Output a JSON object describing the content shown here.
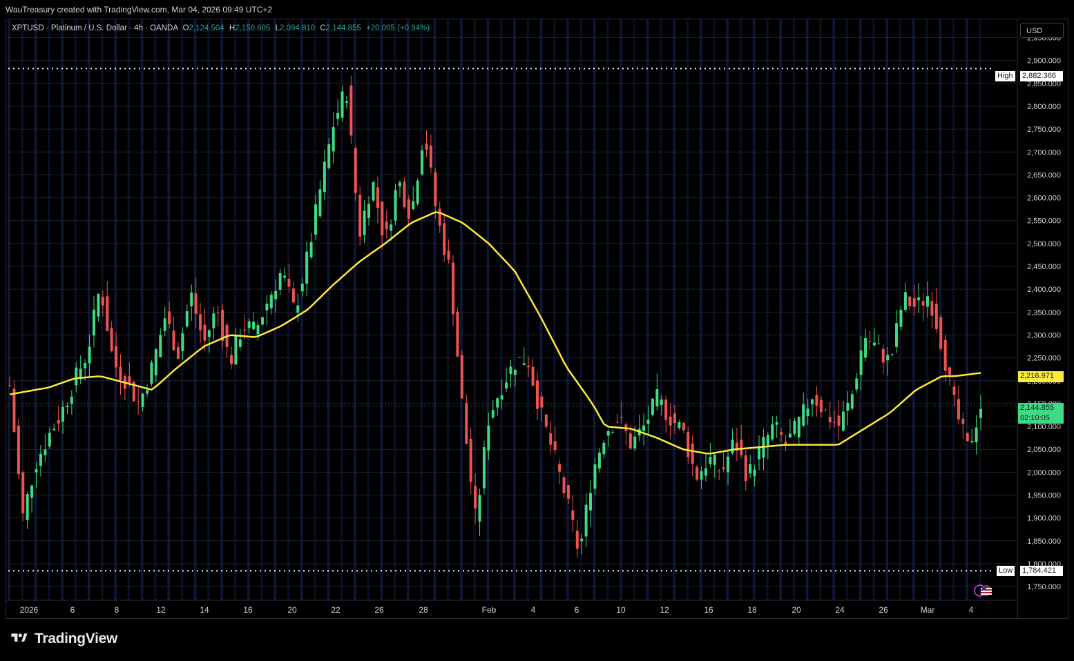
{
  "header": {
    "attribution": "WauTreasury created with TradingView.com, Mar 04, 2026 09:49 UTC+2"
  },
  "legend": {
    "symbol": "XPTUSD",
    "description": "Platinum / U.S. Dollar",
    "interval": "4h",
    "source": "OANDA",
    "open_key": "O",
    "open": "2,124.504",
    "high_key": "H",
    "high": "2,150.605",
    "low_key": "L",
    "low": "2,094.810",
    "close_key": "C",
    "close": "2,144.855",
    "change": "+20.005 (+0.94%)"
  },
  "currency_button": "USD",
  "markers": {
    "high_label": "High",
    "high_value": "2,882.366",
    "low_label": "Low",
    "low_value": "1,784.421",
    "ma_value": "2,216.971",
    "last_price": "2,144.855",
    "countdown": "02:10:05"
  },
  "brand": "TradingView",
  "colors": {
    "up": "#26a69a",
    "up_bright": "#3ddc84",
    "down": "#ef5350",
    "ma": "#ffeb3b",
    "session_band": "#1c2a6e",
    "grid": "#1e222d"
  },
  "chart_data": {
    "type": "candlestick",
    "interval": "4h",
    "ylim": [
      1720,
      2990
    ],
    "y_ticks": [
      "2,950.000",
      "2,900.000",
      "2,850.000",
      "2,800.000",
      "2,750.000",
      "2,700.000",
      "2,650.000",
      "2,600.000",
      "2,550.000",
      "2,500.000",
      "2,450.000",
      "2,400.000",
      "2,350.000",
      "2,300.000",
      "2,250.000",
      "2,200.000",
      "2,150.000",
      "2,100.000",
      "2,050.000",
      "2,000.000",
      "1,950.000",
      "1,900.000",
      "1,850.000",
      "1,800.000",
      "1,750.000"
    ],
    "x_ticks": [
      "2026",
      "6",
      "8",
      "12",
      "14",
      "16",
      "20",
      "22",
      "26",
      "28",
      "Feb",
      "4",
      "6",
      "10",
      "12",
      "16",
      "18",
      "20",
      "24",
      "26",
      "Mar",
      "4"
    ],
    "high": 2882.366,
    "low": 1784.421,
    "last": 2144.855,
    "price_path": [
      [
        0,
        2190
      ],
      [
        1,
        1900
      ],
      [
        2,
        2020
      ],
      [
        3,
        2080
      ],
      [
        4,
        2130
      ],
      [
        5,
        2200
      ],
      [
        6,
        2260
      ],
      [
        7,
        2410
      ],
      [
        8,
        2240
      ],
      [
        9,
        2200
      ],
      [
        10,
        2150
      ],
      [
        11,
        2230
      ],
      [
        12,
        2340
      ],
      [
        13,
        2260
      ],
      [
        14,
        2390
      ],
      [
        15,
        2280
      ],
      [
        16,
        2360
      ],
      [
        17,
        2240
      ],
      [
        18,
        2320
      ],
      [
        19,
        2310
      ],
      [
        20,
        2380
      ],
      [
        21,
        2440
      ],
      [
        22,
        2350
      ],
      [
        23,
        2470
      ],
      [
        24,
        2620
      ],
      [
        25,
        2760
      ],
      [
        26,
        2840
      ],
      [
        27,
        2520
      ],
      [
        28,
        2640
      ],
      [
        29,
        2500
      ],
      [
        30,
        2640
      ],
      [
        31,
        2560
      ],
      [
        32,
        2750
      ],
      [
        33,
        2560
      ],
      [
        34,
        2440
      ],
      [
        35,
        2130
      ],
      [
        36,
        1890
      ],
      [
        37,
        2120
      ],
      [
        38,
        2190
      ],
      [
        39,
        2240
      ],
      [
        40,
        2250
      ],
      [
        41,
        2130
      ],
      [
        42,
        2040
      ],
      [
        43,
        1940
      ],
      [
        44,
        1820
      ],
      [
        45,
        2000
      ],
      [
        46,
        2090
      ],
      [
        47,
        2120
      ],
      [
        48,
        2060
      ],
      [
        49,
        2100
      ],
      [
        50,
        2160
      ],
      [
        51,
        2120
      ],
      [
        52,
        2090
      ],
      [
        53,
        1990
      ],
      [
        54,
        2030
      ],
      [
        55,
        2000
      ],
      [
        56,
        2070
      ],
      [
        57,
        1990
      ],
      [
        58,
        2050
      ],
      [
        59,
        2100
      ],
      [
        60,
        2060
      ],
      [
        61,
        2110
      ],
      [
        62,
        2170
      ],
      [
        63,
        2130
      ],
      [
        64,
        2100
      ],
      [
        65,
        2160
      ],
      [
        66,
        2300
      ],
      [
        67,
        2270
      ],
      [
        68,
        2240
      ],
      [
        69,
        2380
      ],
      [
        70,
        2360
      ],
      [
        71,
        2390
      ],
      [
        72,
        2280
      ],
      [
        73,
        2140
      ],
      [
        74,
        2050
      ],
      [
        75,
        2145
      ]
    ],
    "ma_path": [
      [
        0,
        2170
      ],
      [
        3,
        2185
      ],
      [
        5,
        2205
      ],
      [
        7,
        2210
      ],
      [
        9,
        2195
      ],
      [
        11,
        2180
      ],
      [
        13,
        2230
      ],
      [
        15,
        2275
      ],
      [
        17,
        2300
      ],
      [
        19,
        2295
      ],
      [
        21,
        2320
      ],
      [
        23,
        2355
      ],
      [
        25,
        2410
      ],
      [
        27,
        2460
      ],
      [
        29,
        2500
      ],
      [
        31,
        2545
      ],
      [
        33,
        2570
      ],
      [
        35,
        2545
      ],
      [
        37,
        2500
      ],
      [
        39,
        2440
      ],
      [
        41,
        2340
      ],
      [
        43,
        2230
      ],
      [
        45,
        2150
      ],
      [
        46,
        2100
      ],
      [
        48,
        2095
      ],
      [
        50,
        2075
      ],
      [
        52,
        2050
      ],
      [
        54,
        2040
      ],
      [
        56,
        2050
      ],
      [
        58,
        2055
      ],
      [
        60,
        2060
      ],
      [
        62,
        2060
      ],
      [
        64,
        2060
      ],
      [
        66,
        2095
      ],
      [
        68,
        2130
      ],
      [
        70,
        2180
      ],
      [
        72,
        2210
      ],
      [
        73,
        2210
      ],
      [
        75,
        2217
      ]
    ]
  }
}
